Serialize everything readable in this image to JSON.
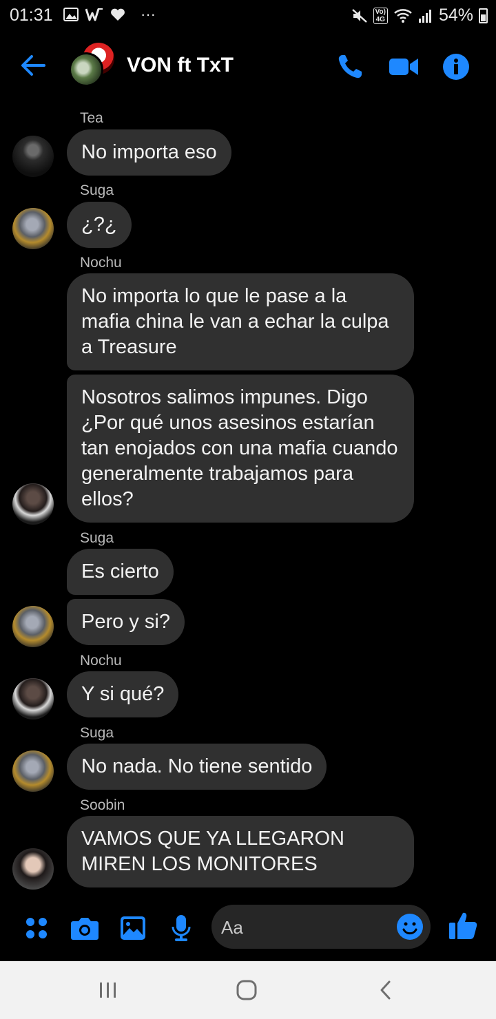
{
  "status_bar": {
    "time": "01:31",
    "overflow": "···",
    "network_badge": "Vo) 4G",
    "battery": "54%"
  },
  "header": {
    "title": "VON ft TxT",
    "back_icon": "arrow-left-icon",
    "call_icon": "phone-icon",
    "video_icon": "video-camera-icon",
    "info_icon": "info-icon"
  },
  "messages": [
    {
      "sender": "Tea",
      "text": "No importa eso"
    },
    {
      "sender": "Suga",
      "text": "¿?¿"
    },
    {
      "sender": "Nochu",
      "text": "No importa lo que le pase a la mafia china le van a echar la culpa a Treasure"
    },
    {
      "sender": "",
      "text": "Nosotros salimos impunes. Digo ¿Por qué unos asesinos estarían tan enojados con una mafia cuando generalmente trabajamos para ellos?"
    },
    {
      "sender": "Suga",
      "text": "Es cierto"
    },
    {
      "sender": "",
      "text": "Pero y si?"
    },
    {
      "sender": "Nochu",
      "text": "Y si qué?"
    },
    {
      "sender": "Suga",
      "text": "No nada. No tiene sentido"
    },
    {
      "sender": "Soobin",
      "text": "VAMOS QUE YA LLEGARON MIREN LOS MONITORES"
    }
  ],
  "composer": {
    "placeholder": "Aa",
    "icons": [
      "menu-dots-icon",
      "camera-icon",
      "gallery-icon",
      "microphone-icon",
      "emoji-icon",
      "thumbs-up-icon"
    ]
  },
  "nav_bar": {
    "icons": [
      "recent-apps-icon",
      "home-icon",
      "back-icon"
    ]
  },
  "colors": {
    "accent": "#1e88ff",
    "bubble": "#303030",
    "background": "#000000",
    "sender_label": "#b9b9b9"
  }
}
